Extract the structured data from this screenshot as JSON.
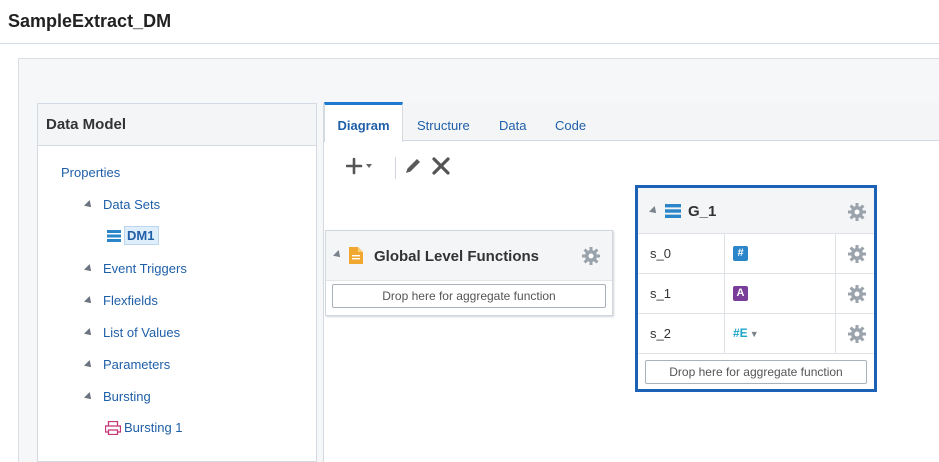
{
  "window": {
    "title": "SampleExtract_DM"
  },
  "sidebar": {
    "header": "Data Model",
    "properties": "Properties",
    "items": [
      {
        "label": "Data Sets"
      },
      {
        "label": "DM1"
      },
      {
        "label": "Event Triggers"
      },
      {
        "label": "Flexfields"
      },
      {
        "label": "List of Values"
      },
      {
        "label": "Parameters"
      },
      {
        "label": "Bursting"
      },
      {
        "label": "Bursting 1"
      }
    ]
  },
  "tabs": [
    {
      "label": "Diagram",
      "active": true
    },
    {
      "label": "Structure"
    },
    {
      "label": "Data"
    },
    {
      "label": "Code"
    }
  ],
  "toolbar": {
    "add_icon": "plus-dropdown-icon",
    "edit_icon": "pencil-icon",
    "delete_icon": "x-icon"
  },
  "global_functions": {
    "title": "Global Level Functions",
    "drop_text": "Drop here for aggregate function"
  },
  "group": {
    "title": "G_1",
    "rows": [
      {
        "name": "s_0",
        "type_icon": "number-icon"
      },
      {
        "name": "s_1",
        "type_icon": "text-icon"
      },
      {
        "name": "s_2",
        "type_icon": "element-dropdown-icon",
        "type_text": "#E"
      }
    ],
    "drop_text": "Drop here for aggregate function"
  },
  "colors": {
    "accent": "#1b62b7",
    "link": "#1f5fa8",
    "number_badge": "#2a86c8",
    "text_badge": "#7b3d9a",
    "printer": "#c8367a",
    "doc": "#f0a830"
  }
}
